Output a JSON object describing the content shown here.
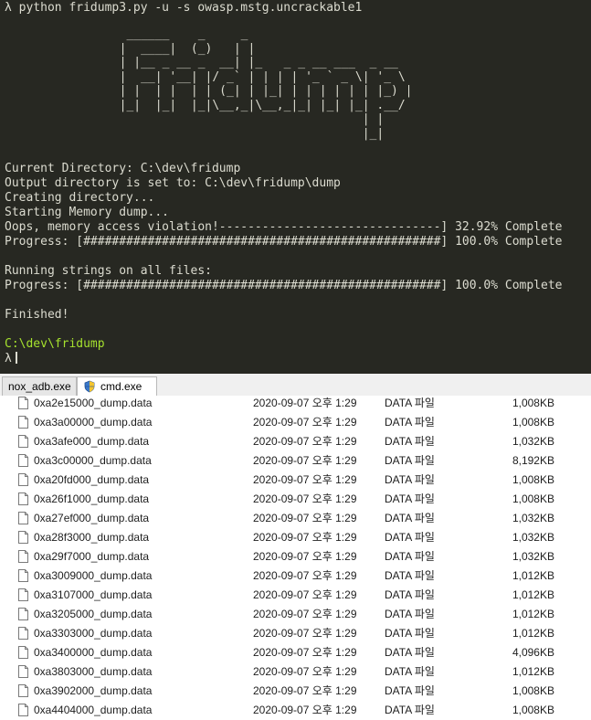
{
  "terminal": {
    "command": "λ python fridump3.py -u -s owasp.mstg.uncrackable1",
    "banner": "         ______    _     _\n        |  ____|  (_)   | |\n        | |__ _ __ _  __| |_   _ _ __ ___  _ __\n        |  __| '__| |/ _` | | | | '_ ` _ \\| '_ \\\n        | |  | |  | | (_| | |_| | | | | | | |_) |\n        |_|  |_|  |_|\\__,_|\\__,_|_| |_| |_| .__/\n                                          | |\n                                          |_|",
    "lines": [
      "Current Directory: C:\\dev\\fridump",
      "Output directory is set to: C:\\dev\\fridump\\dump",
      "Creating directory...",
      "Starting Memory dump...",
      "Oops, memory access violation!-------------------------------] 32.92% Complete",
      "Progress: [##################################################] 100.0% Complete",
      "",
      "Running strings on all files:",
      "Progress: [##################################################] 100.0% Complete",
      "",
      "Finished!",
      "",
      "C:\\dev\\fridump",
      "λ"
    ],
    "colors": {
      "background": "#272822",
      "text": "#dcdcd0",
      "path": "#a6e22e"
    }
  },
  "tabs": [
    {
      "label": "nox_adb.exe",
      "active": false
    },
    {
      "label": "cmd.exe",
      "active": true,
      "icon": "shield-icon"
    }
  ],
  "files": [
    {
      "name": "0xa2e15000_dump.data",
      "date": "2020-09-07 오후 1:29",
      "type": "DATA 파일",
      "size": "1,008KB"
    },
    {
      "name": "0xa3a00000_dump.data",
      "date": "2020-09-07 오후 1:29",
      "type": "DATA 파일",
      "size": "1,008KB"
    },
    {
      "name": "0xa3afe000_dump.data",
      "date": "2020-09-07 오후 1:29",
      "type": "DATA 파일",
      "size": "1,032KB"
    },
    {
      "name": "0xa3c00000_dump.data",
      "date": "2020-09-07 오후 1:29",
      "type": "DATA 파일",
      "size": "8,192KB"
    },
    {
      "name": "0xa20fd000_dump.data",
      "date": "2020-09-07 오후 1:29",
      "type": "DATA 파일",
      "size": "1,008KB"
    },
    {
      "name": "0xa26f1000_dump.data",
      "date": "2020-09-07 오후 1:29",
      "type": "DATA 파일",
      "size": "1,008KB"
    },
    {
      "name": "0xa27ef000_dump.data",
      "date": "2020-09-07 오후 1:29",
      "type": "DATA 파일",
      "size": "1,032KB"
    },
    {
      "name": "0xa28f3000_dump.data",
      "date": "2020-09-07 오후 1:29",
      "type": "DATA 파일",
      "size": "1,032KB"
    },
    {
      "name": "0xa29f7000_dump.data",
      "date": "2020-09-07 오후 1:29",
      "type": "DATA 파일",
      "size": "1,032KB"
    },
    {
      "name": "0xa3009000_dump.data",
      "date": "2020-09-07 오후 1:29",
      "type": "DATA 파일",
      "size": "1,012KB"
    },
    {
      "name": "0xa3107000_dump.data",
      "date": "2020-09-07 오후 1:29",
      "type": "DATA 파일",
      "size": "1,012KB"
    },
    {
      "name": "0xa3205000_dump.data",
      "date": "2020-09-07 오후 1:29",
      "type": "DATA 파일",
      "size": "1,012KB"
    },
    {
      "name": "0xa3303000_dump.data",
      "date": "2020-09-07 오후 1:29",
      "type": "DATA 파일",
      "size": "1,012KB"
    },
    {
      "name": "0xa3400000_dump.data",
      "date": "2020-09-07 오후 1:29",
      "type": "DATA 파일",
      "size": "4,096KB"
    },
    {
      "name": "0xa3803000_dump.data",
      "date": "2020-09-07 오후 1:29",
      "type": "DATA 파일",
      "size": "1,012KB"
    },
    {
      "name": "0xa3902000_dump.data",
      "date": "2020-09-07 오후 1:29",
      "type": "DATA 파일",
      "size": "1,008KB"
    },
    {
      "name": "0xa4404000_dump.data",
      "date": "2020-09-07 오후 1:29",
      "type": "DATA 파일",
      "size": "1,008KB"
    }
  ]
}
